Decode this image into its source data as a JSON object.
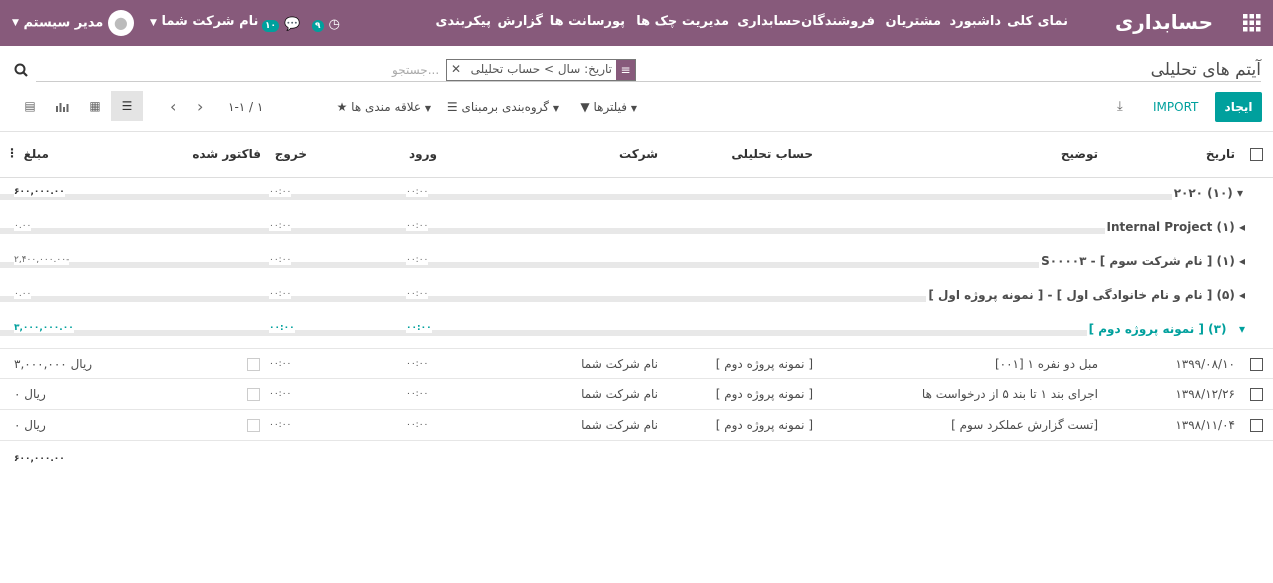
{
  "topbar": {
    "brand": "حسابداری",
    "menu": [
      "نمای کلی",
      "داشبورد",
      "مشتریان",
      "فروشندگان",
      "حسابداری",
      "مدیریت چک ها",
      "پورسانت ها",
      "گزارش",
      "پیکربندی"
    ],
    "activity_count": "۹",
    "messages_count": "۱۰",
    "company": "نام شرکت شما",
    "user": "مدیر سیستم"
  },
  "cp": {
    "title": "آیتم های تحلیلی",
    "create": "ایجاد",
    "import": "IMPORT",
    "facet": "تاریخ: سال > حساب تحلیلی",
    "search_placeholder": "جستجو...",
    "filters": "فیلترها",
    "groupby": "گروه‌بندی برمبنای",
    "favorites": "علاقه مندی ها",
    "pager": "۱-۱ / ۱"
  },
  "headers": {
    "date": "تاریخ",
    "desc": "توضیح",
    "account": "حساب تحلیلی",
    "company": "شرکت",
    "in": "ورود",
    "out": "خروج",
    "invoiced": "فاکتور شده",
    "amount": "مبلغ"
  },
  "groups": [
    {
      "label": "۲۰۲۰ (۱۰)",
      "in": "۰۰:۰۰",
      "out": "۰۰:۰۰",
      "amount": "۶۰۰,۰۰۰.۰۰"
    },
    {
      "label": "Internal Project (۱)",
      "in": "۰۰:۰۰",
      "out": "۰۰:۰۰",
      "amount": "۰.۰۰"
    },
    {
      "label": "S۰۰۰۰۳ - [ نام شرکت سوم ] (۱)",
      "in": "۰۰:۰۰",
      "out": "۰۰:۰۰",
      "amount": "۲,۴۰۰,۰۰۰.۰۰-"
    },
    {
      "label": "[ نمونه پروژه اول ] - [ نام و نام خانوادگی اول ] (۵)",
      "in": "۰۰:۰۰",
      "out": "۰۰:۰۰",
      "amount": "۰.۰۰"
    },
    {
      "label": "[ نمونه پروژه دوم ] (۳)",
      "in": "۰۰:۰۰",
      "out": "۰۰:۰۰",
      "amount": "۳,۰۰۰,۰۰۰.۰۰"
    }
  ],
  "rows": [
    {
      "date": "۱۳۹۹/۰۸/۱۰",
      "desc": "[۰۰۱] مبل دو نفره ۱",
      "account": "[ نمونه پروژه دوم ]",
      "company": "نام شرکت شما",
      "in": "۰۰:۰۰",
      "out": "۰۰:۰۰",
      "amount": "۳,۰۰۰,۰۰۰ ریال"
    },
    {
      "date": "۱۳۹۸/۱۲/۲۶",
      "desc": "اجرای بند ۱ تا بند ۵ از درخواست ها",
      "account": "[ نمونه پروژه دوم ]",
      "company": "نام شرکت شما",
      "in": "۰۰:۰۰",
      "out": "۰۰:۰۰",
      "amount": "۰ ریال"
    },
    {
      "date": "۱۳۹۸/۱۱/۰۴",
      "desc": "[ تست گزارش عملکرد سوم]",
      "account": "[ نمونه پروژه دوم ]",
      "company": "نام شرکت شما",
      "in": "۰۰:۰۰",
      "out": "۰۰:۰۰",
      "amount": "۰ ریال"
    }
  ],
  "total": "۶۰۰,۰۰۰.۰۰",
  "colors": {
    "topbar": "#875a7b",
    "accent": "#00a09d"
  }
}
